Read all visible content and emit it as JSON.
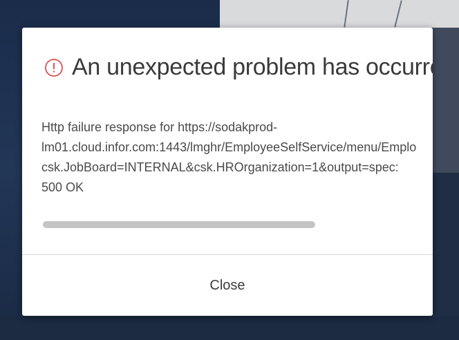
{
  "dialog": {
    "title": "An unexpected problem has occurred",
    "icon": "alert-circle-icon",
    "message_lines": [
      "Http failure response for https://sodakprod-",
      "lm01.cloud.infor.com:1443/lmghr/EmployeeSelfService/menu/Emplo",
      "csk.JobBoard=INTERNAL&csk.HROrganization=1&output=spec:",
      "500 OK"
    ],
    "close_label": "Close"
  },
  "colors": {
    "alert_red": "#d9534f",
    "title_text": "#3a3a3a",
    "body_text": "#4a4a4a",
    "background_dark": "#1f2e44"
  }
}
